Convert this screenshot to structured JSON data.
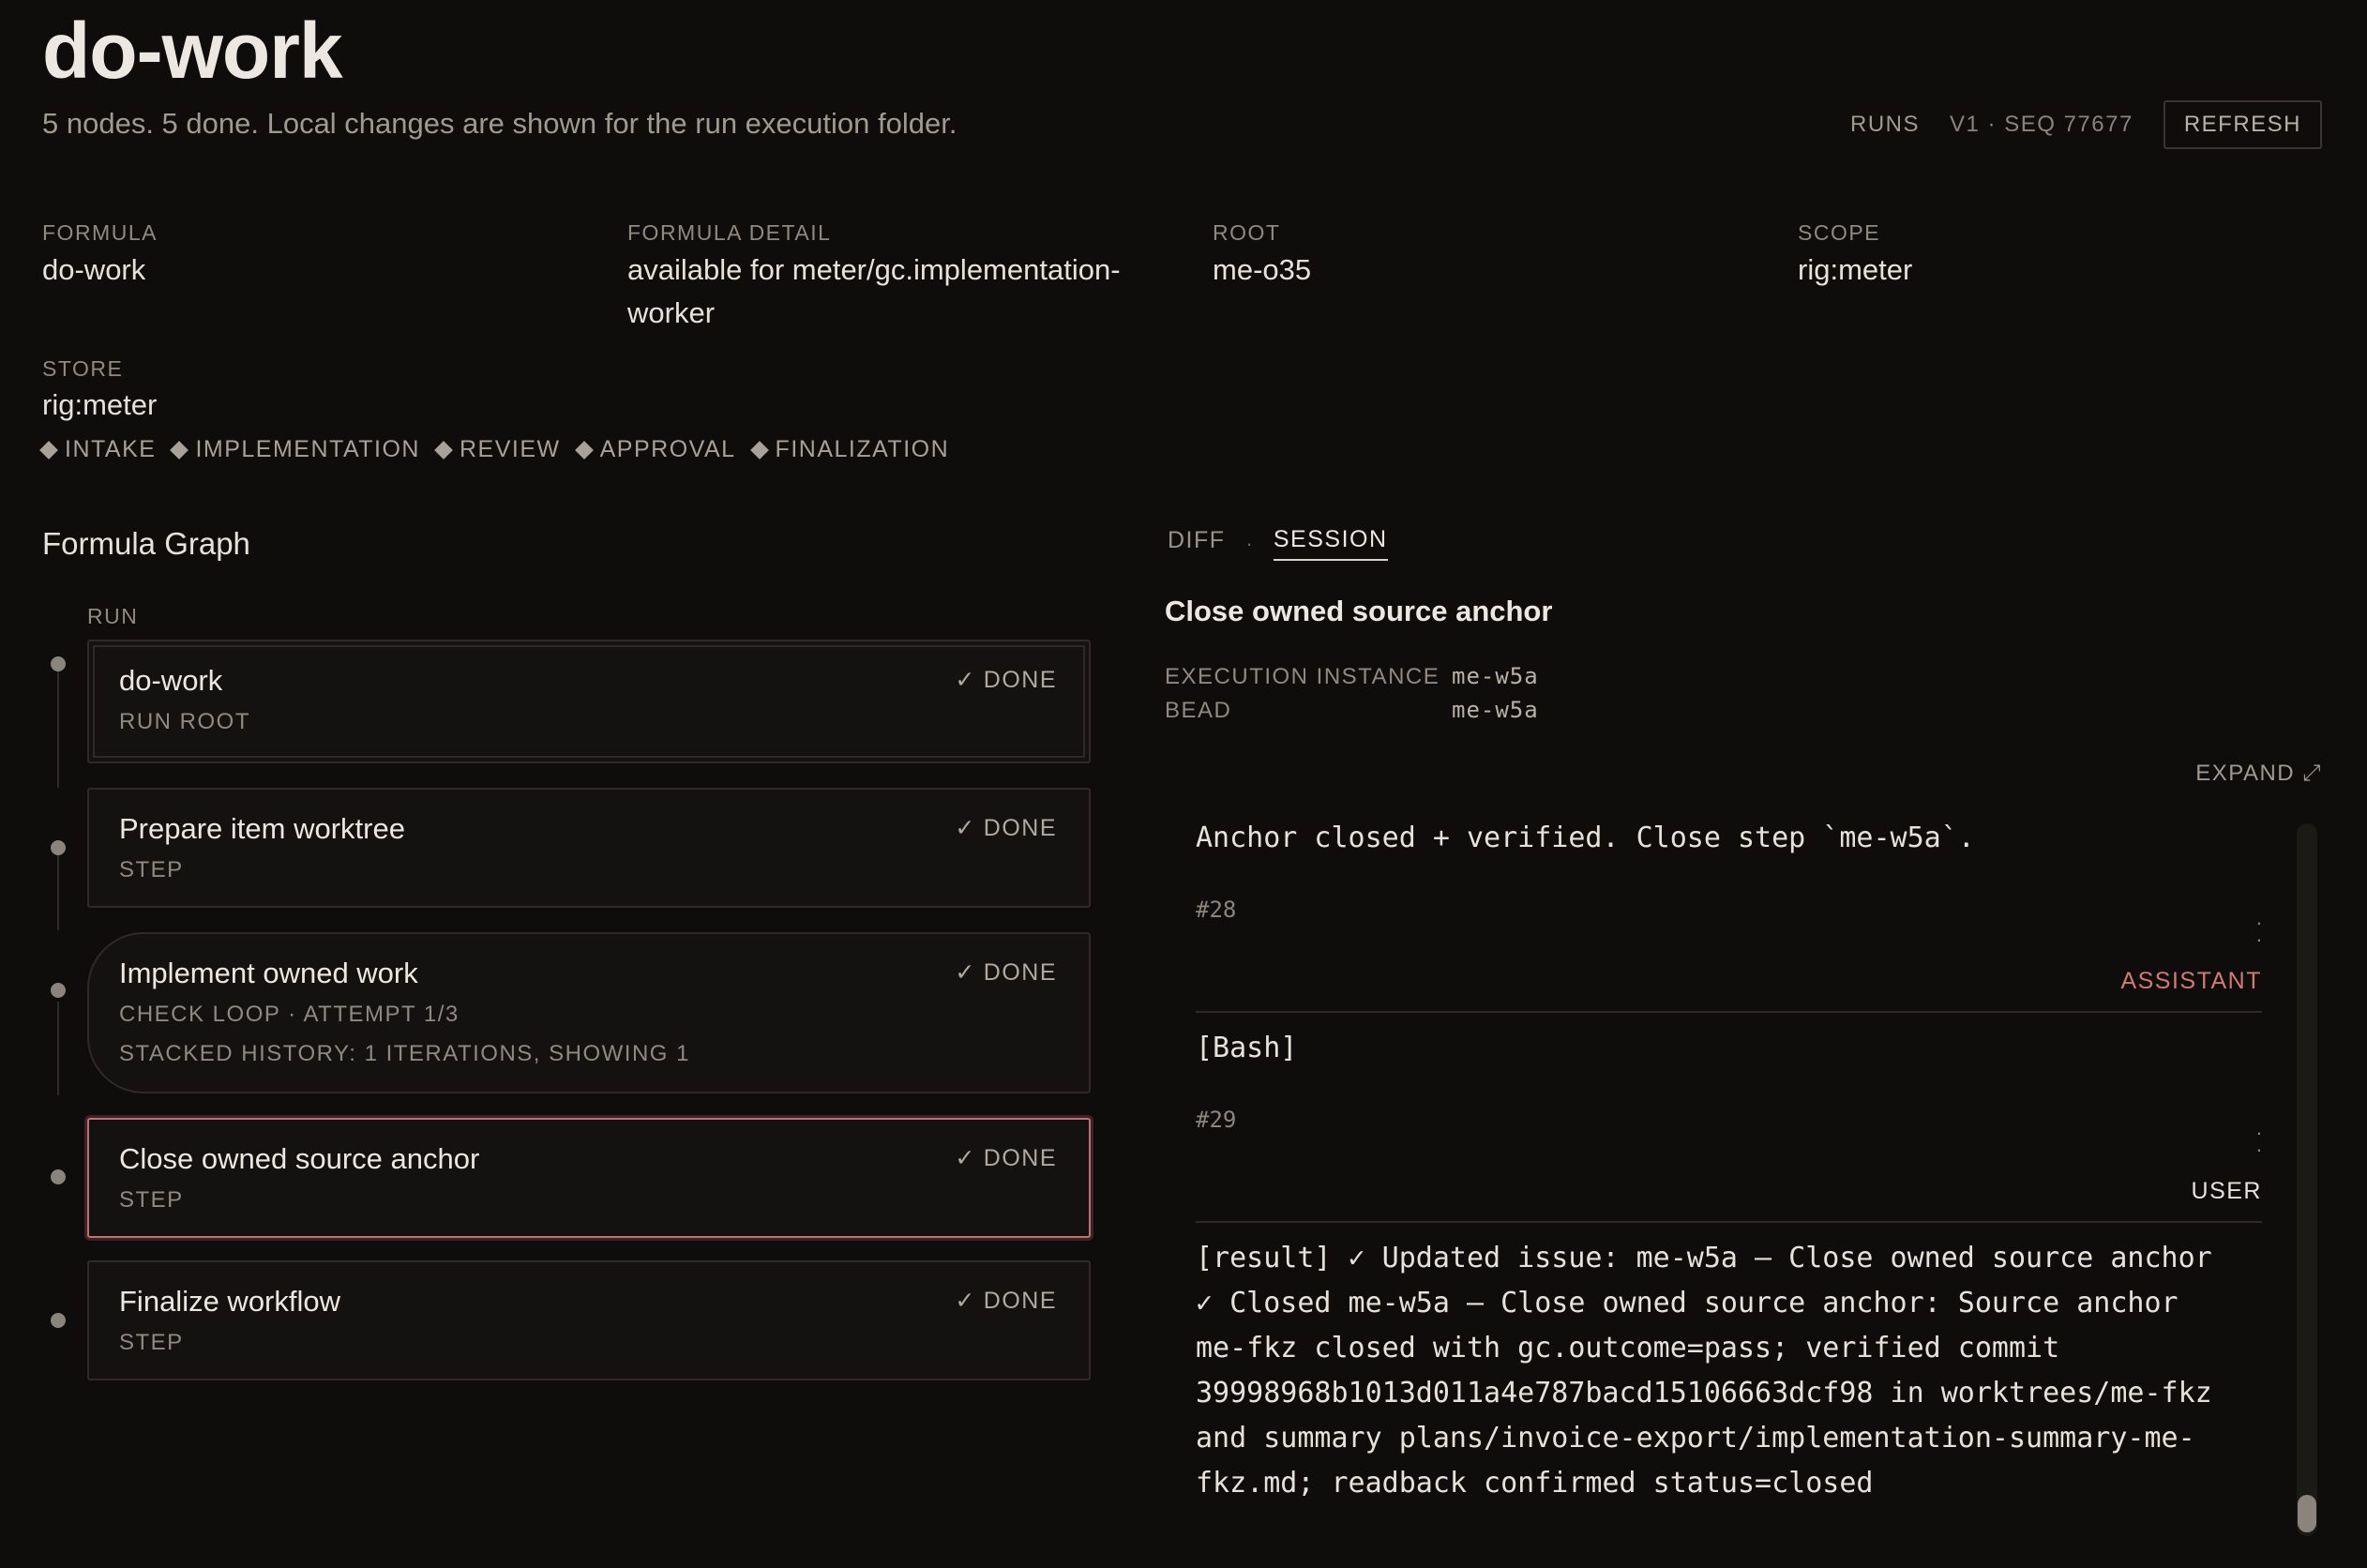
{
  "header": {
    "title": "do-work",
    "subtitle": "5 nodes. 5 done. Local changes are shown for the run execution folder.",
    "runs_label": "RUNS",
    "seq_label": "V1 · SEQ 77677",
    "refresh_label": "REFRESH"
  },
  "meta": {
    "formula_label": "FORMULA",
    "formula_value": "do-work",
    "detail_label": "FORMULA DETAIL",
    "detail_value_line1": "available for meter/gc.implementation-",
    "detail_value_line2": "worker",
    "root_label": "ROOT",
    "root_value": "me-o35",
    "scope_label": "SCOPE",
    "scope_value": "rig:meter",
    "store_label": "STORE",
    "store_value": "rig:meter"
  },
  "phases": [
    "INTAKE",
    "IMPLEMENTATION",
    "REVIEW",
    "APPROVAL",
    "FINALIZATION"
  ],
  "graph": {
    "title": "Formula Graph",
    "run_label": "RUN",
    "nodes": [
      {
        "title": "do-work",
        "sub": "RUN ROOT",
        "status": "DONE"
      },
      {
        "title": "Prepare item worktree",
        "sub": "STEP",
        "status": "DONE"
      },
      {
        "title": "Implement owned work",
        "sub": "CHECK LOOP · ATTEMPT 1/3",
        "sub2": "STACKED HISTORY: 1 ITERATIONS, SHOWING 1",
        "status": "DONE"
      },
      {
        "title": "Close owned source anchor",
        "sub": "STEP",
        "status": "DONE"
      },
      {
        "title": "Finalize workflow",
        "sub": "STEP",
        "status": "DONE"
      }
    ]
  },
  "panel": {
    "tabs": [
      "DIFF",
      "SESSION"
    ],
    "active_tab": "SESSION",
    "title": "Close owned source anchor",
    "execution_label": "EXECUTION INSTANCE",
    "execution_value": "me-w5a",
    "bead_label": "BEAD",
    "bead_value": "me-w5a",
    "expand_label": "EXPAND ⤢",
    "messages": [
      {
        "text": "Anchor closed + verified. Close step `me-w5a`.",
        "num": "#28",
        "role": "ASSISTANT"
      },
      {
        "text": "[Bash]",
        "num": "#29",
        "role": "USER"
      },
      {
        "text": "[result] ✓ Updated issue: me-w5a — Close owned source anchor\n✓ Closed me-w5a — Close owned source anchor: Source anchor\nme-fkz closed with gc.outcome=pass; verified commit\n39998968b1013d011a4e787bacd15106663dcf98 in worktrees/me-fkz\nand summary plans/invoice-export/implementation-summary-me-\nfkz.md; readback confirmed status=closed"
      }
    ]
  }
}
